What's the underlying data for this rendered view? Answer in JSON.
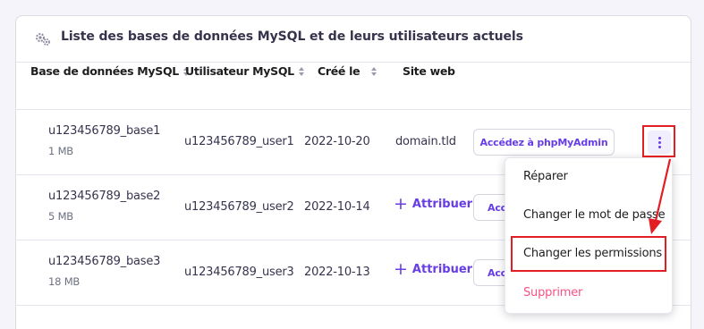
{
  "card": {
    "title": "Liste des bases de données MySQL et de leurs utilisateurs actuels"
  },
  "table": {
    "headers": [
      "Base de données MySQL",
      "Utilisateur MySQL",
      "Créé le",
      "Site web"
    ],
    "rows": [
      {
        "database": "u123456789_base1",
        "size": "1 MB",
        "user": "u123456789_user1",
        "created": "2022-10-20",
        "website": "domain.tld",
        "action": "Accédez à phpMyAdmin"
      },
      {
        "database": "u123456789_base2",
        "size": "5 MB",
        "user": "u123456789_user2",
        "created": "2022-10-14",
        "website": "Attribuer",
        "action": "Acc"
      },
      {
        "database": "u123456789_base3",
        "size": "18 MB",
        "user": "u123456789_user3",
        "created": "2022-10-13",
        "website": "Attribuer",
        "action": "Acc"
      }
    ]
  },
  "icons": {
    "header": "gears-icon",
    "menu_trigger": "kebab-vertical-icon",
    "attribute": "plus-icon"
  },
  "menu": {
    "items": [
      "Réparer",
      "Changer le mot de passe",
      "Changer les permissions",
      "Supprimer"
    ]
  },
  "colors": {
    "accent": "#673de6",
    "danger": "#fc5185",
    "highlight": "#e21d24",
    "text": "#1d1e20",
    "border": "#e4e4ec"
  }
}
